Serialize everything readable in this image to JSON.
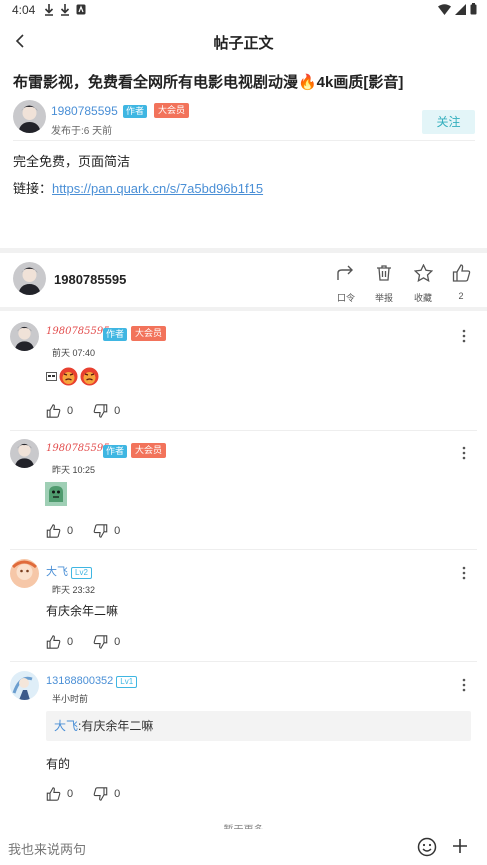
{
  "status": {
    "time": "4:04"
  },
  "appbar": {
    "title": "帖子正文"
  },
  "post": {
    "title": "布雷影视，免费看全网所有电影电视剧动漫🔥4k画质[影音]",
    "author": "1980785595",
    "author_badge": "作者",
    "vip_badge": "大会员",
    "published": "发布于:6 天前",
    "follow_label": "关注",
    "line1": "完全免费，页面简洁",
    "link_prefix": "链接：",
    "link_url": "https://pan.quark.cn/s/7a5bd96b1f15"
  },
  "action_bar": {
    "name": "1980785595",
    "share_label": "口令",
    "report_label": "举报",
    "fav_label": "收藏",
    "like_count": "2"
  },
  "comments": [
    {
      "name": "1980785595",
      "author_badge": "作者",
      "vip_badge": "大会员",
      "time": "前天 07:40",
      "up": "0",
      "down": "0"
    },
    {
      "name": "1980785595",
      "author_badge": "作者",
      "vip_badge": "大会员",
      "time": "昨天 10:25",
      "up": "0",
      "down": "0"
    },
    {
      "name": "大飞",
      "level": "Lv2",
      "time": "昨天 23:32",
      "text": "有庆余年二嘛",
      "up": "0",
      "down": "0"
    },
    {
      "name": "13188800352",
      "level": "Lv1",
      "time": "半小时前",
      "quote_name": "大飞",
      "quote_text": ":有庆余年二嘛",
      "text": "有的",
      "up": "0",
      "down": "0"
    }
  ],
  "no_more": "暂无更多",
  "bottom": {
    "placeholder": "我也来说两句"
  },
  "colors": {
    "accent": "#4a8fd6",
    "author_badge": "#3fb6e2",
    "vip_badge": "#f2735b",
    "follow_bg": "#e3f5f8"
  }
}
